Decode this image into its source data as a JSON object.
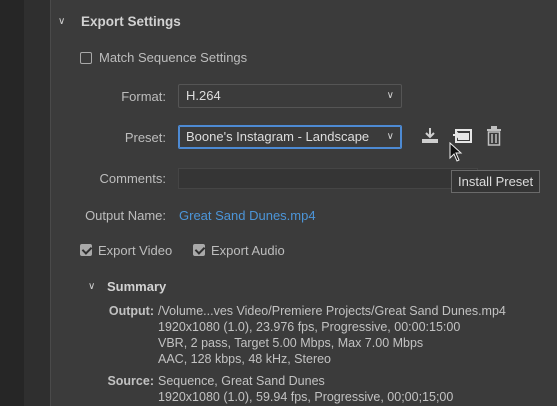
{
  "export_settings": {
    "title": "Export Settings",
    "match_sequence": {
      "label": "Match Sequence Settings",
      "checked": false
    },
    "format": {
      "label": "Format:",
      "value": "H.264"
    },
    "preset": {
      "label": "Preset:",
      "value": "Boone's Instagram - Landscape"
    },
    "preset_icons": [
      "import-preset-icon",
      "install-preset-icon",
      "delete-preset-icon"
    ],
    "comments": {
      "label": "Comments:",
      "value": ""
    },
    "tooltip": "Install Preset",
    "output_name": {
      "label": "Output Name:",
      "value": "Great Sand Dunes.mp4"
    },
    "export_video": {
      "label": "Export Video",
      "checked": true
    },
    "export_audio": {
      "label": "Export Audio",
      "checked": true
    }
  },
  "summary": {
    "title": "Summary",
    "output": {
      "label": "Output:",
      "lines": [
        "/Volume...ves Video/Premiere Projects/Great Sand Dunes.mp4",
        "1920x1080 (1.0), 23.976 fps, Progressive, 00:00:15:00",
        "VBR, 2 pass, Target 5.00 Mbps, Max 7.00 Mbps",
        "AAC, 128 kbps, 48 kHz, Stereo"
      ]
    },
    "source": {
      "label": "Source:",
      "lines": [
        "Sequence, Great Sand Dunes",
        "1920x1080 (1.0), 59.94 fps, Progressive, 00;00;15;00"
      ]
    }
  },
  "colors": {
    "panel": "#3b3b3b",
    "accent_focus": "#4d8ad3",
    "link": "#4c95d8"
  }
}
